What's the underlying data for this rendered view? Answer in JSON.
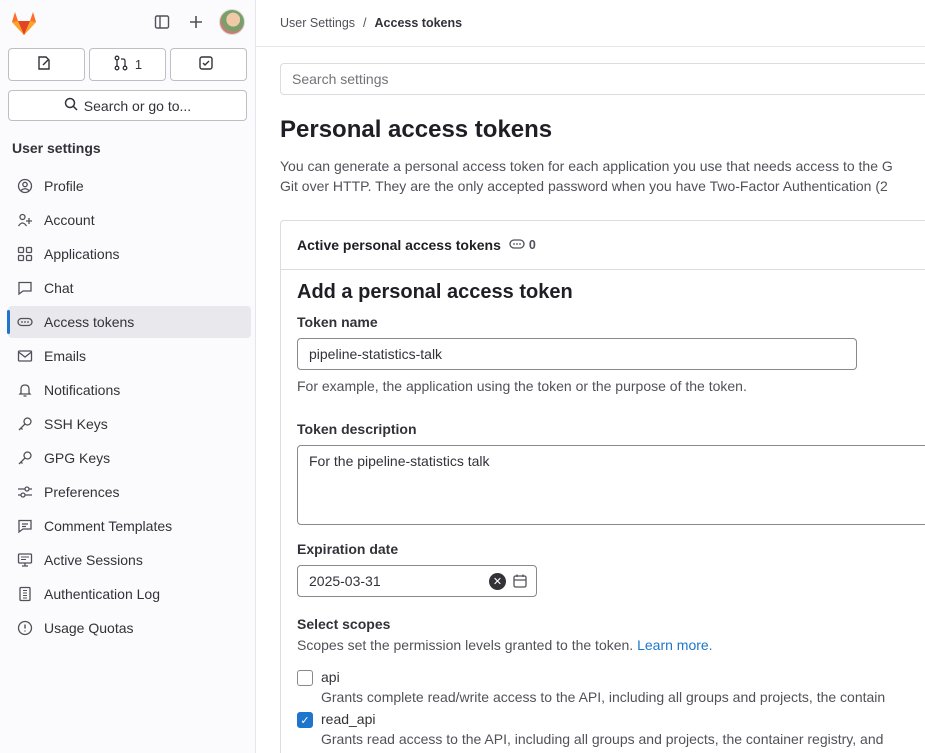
{
  "sidebar": {
    "quick_actions": [
      {
        "icon": "issues-icon",
        "label": ""
      },
      {
        "icon": "merge-request-icon",
        "label": "1"
      },
      {
        "icon": "todo-icon",
        "label": ""
      }
    ],
    "search_label": "Search or go to...",
    "heading": "User settings",
    "items": [
      {
        "label": "Profile",
        "icon": "profile-icon"
      },
      {
        "label": "Account",
        "icon": "account-icon"
      },
      {
        "label": "Applications",
        "icon": "applications-icon"
      },
      {
        "label": "Chat",
        "icon": "chat-icon"
      },
      {
        "label": "Access tokens",
        "icon": "token-icon",
        "active": true
      },
      {
        "label": "Emails",
        "icon": "mail-icon"
      },
      {
        "label": "Notifications",
        "icon": "bell-icon"
      },
      {
        "label": "SSH Keys",
        "icon": "key-icon"
      },
      {
        "label": "GPG Keys",
        "icon": "key-icon"
      },
      {
        "label": "Preferences",
        "icon": "preferences-icon"
      },
      {
        "label": "Comment Templates",
        "icon": "comment-icon"
      },
      {
        "label": "Active Sessions",
        "icon": "monitor-icon"
      },
      {
        "label": "Authentication Log",
        "icon": "log-icon"
      },
      {
        "label": "Usage Quotas",
        "icon": "quota-icon"
      }
    ]
  },
  "breadcrumb": {
    "parent": "User Settings",
    "separator": "/",
    "current": "Access tokens"
  },
  "search_settings": {
    "placeholder": "Search settings"
  },
  "page": {
    "title": "Personal access tokens",
    "desc_line1": "You can generate a personal access token for each application you use that needs access to the G",
    "desc_line2": "Git over HTTP. They are the only accepted password when you have Two-Factor Authentication (2"
  },
  "card": {
    "title": "Active personal access tokens",
    "count": "0"
  },
  "form": {
    "heading": "Add a personal access token",
    "token_name_label": "Token name",
    "token_name_value": "pipeline-statistics-talk",
    "token_name_help": "For example, the application using the token or the purpose of the token.",
    "description_label": "Token description",
    "description_value": "For the pipeline-statistics talk",
    "expiration_label": "Expiration date",
    "expiration_value": "2025-03-31",
    "scopes_label": "Select scopes",
    "scopes_help": "Scopes set the permission levels granted to the token.",
    "learn_more": "Learn more.",
    "scopes": [
      {
        "name": "api",
        "checked": false,
        "desc": "Grants complete read/write access to the API, including all groups and projects, the contain"
      },
      {
        "name": "read_api",
        "checked": true,
        "desc": "Grants read access to the API, including all groups and projects, the container registry, and"
      }
    ]
  },
  "colors": {
    "accent": "#1f75cb",
    "sidebar_bg": "#fbfafd",
    "active_item": "#e9e8ed"
  }
}
